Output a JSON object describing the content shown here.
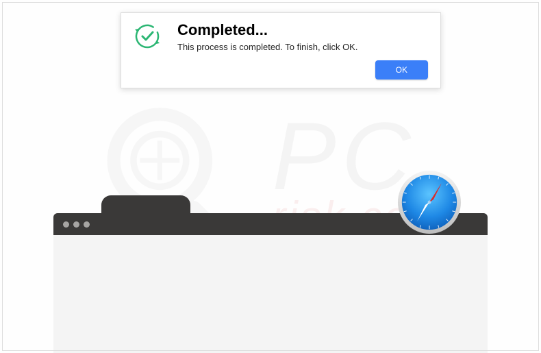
{
  "dialog": {
    "title": "Completed...",
    "message": "This process is completed. To finish, click OK.",
    "ok_label": "OK"
  },
  "colors": {
    "accent": "#3b7ff8",
    "success_ring": "#2bb673",
    "chrome": "#3a3938",
    "body": "#f4f4f4"
  },
  "watermark": {
    "line1": "PC",
    "line2": "risk.com"
  }
}
